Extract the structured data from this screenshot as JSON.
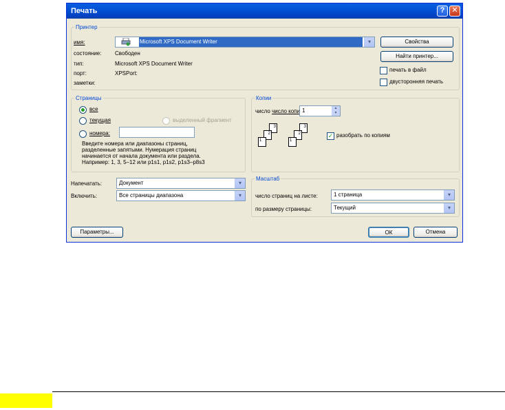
{
  "window": {
    "title": "Печать"
  },
  "printer": {
    "legend": "Принтер",
    "name_label": "имя:",
    "name_value": "Microsoft XPS Document Writer",
    "status_label": "состояние:",
    "status_value": "Свободен",
    "type_label": "тип:",
    "type_value": "Microsoft XPS Document Writer",
    "port_label": "порт:",
    "port_value": "XPSPort:",
    "notes_label": "заметки:",
    "properties_button": "Свойства",
    "find_printer_button": "Найти принтер...",
    "print_to_file_label": "печать в файл",
    "duplex_label": "двусторонняя печать"
  },
  "pages": {
    "legend": "Страницы",
    "all_label": "все",
    "current_label": "текущая",
    "selection_label": "выделенный фрагмент",
    "numbers_label": "номера:",
    "numbers_value": "",
    "hint_lines": [
      "Введите номера или диапазоны страниц,",
      "разделенные запятыми. Нумерация страниц",
      "начинается от начала документа или раздела.",
      "Например: 1, 3, 5–12 или p1s1, p1s2, p1s3–p8s3"
    ]
  },
  "copies": {
    "legend": "Копии",
    "count_label": "число копий:",
    "count_value": "1",
    "collate_label": "разобрать по копиям",
    "collate_checked": true
  },
  "print_what": {
    "label": "Напечатать:",
    "value": "Документ"
  },
  "include": {
    "label": "Включить:",
    "value": "Все страницы диапазона"
  },
  "scale": {
    "legend": "Масштаб",
    "pages_per_sheet_label": "число страниц на листе:",
    "pages_per_sheet_value": "1 страница",
    "fit_label": "по размеру страницы:",
    "fit_value": "Текущий"
  },
  "buttons": {
    "options": "Параметры...",
    "ok": "ОК",
    "cancel": "Отмена"
  },
  "icons": {
    "help": "?",
    "close": "✕",
    "dropdown": "▾",
    "spin_up": "▲",
    "spin_down": "▼",
    "check": "✓"
  }
}
